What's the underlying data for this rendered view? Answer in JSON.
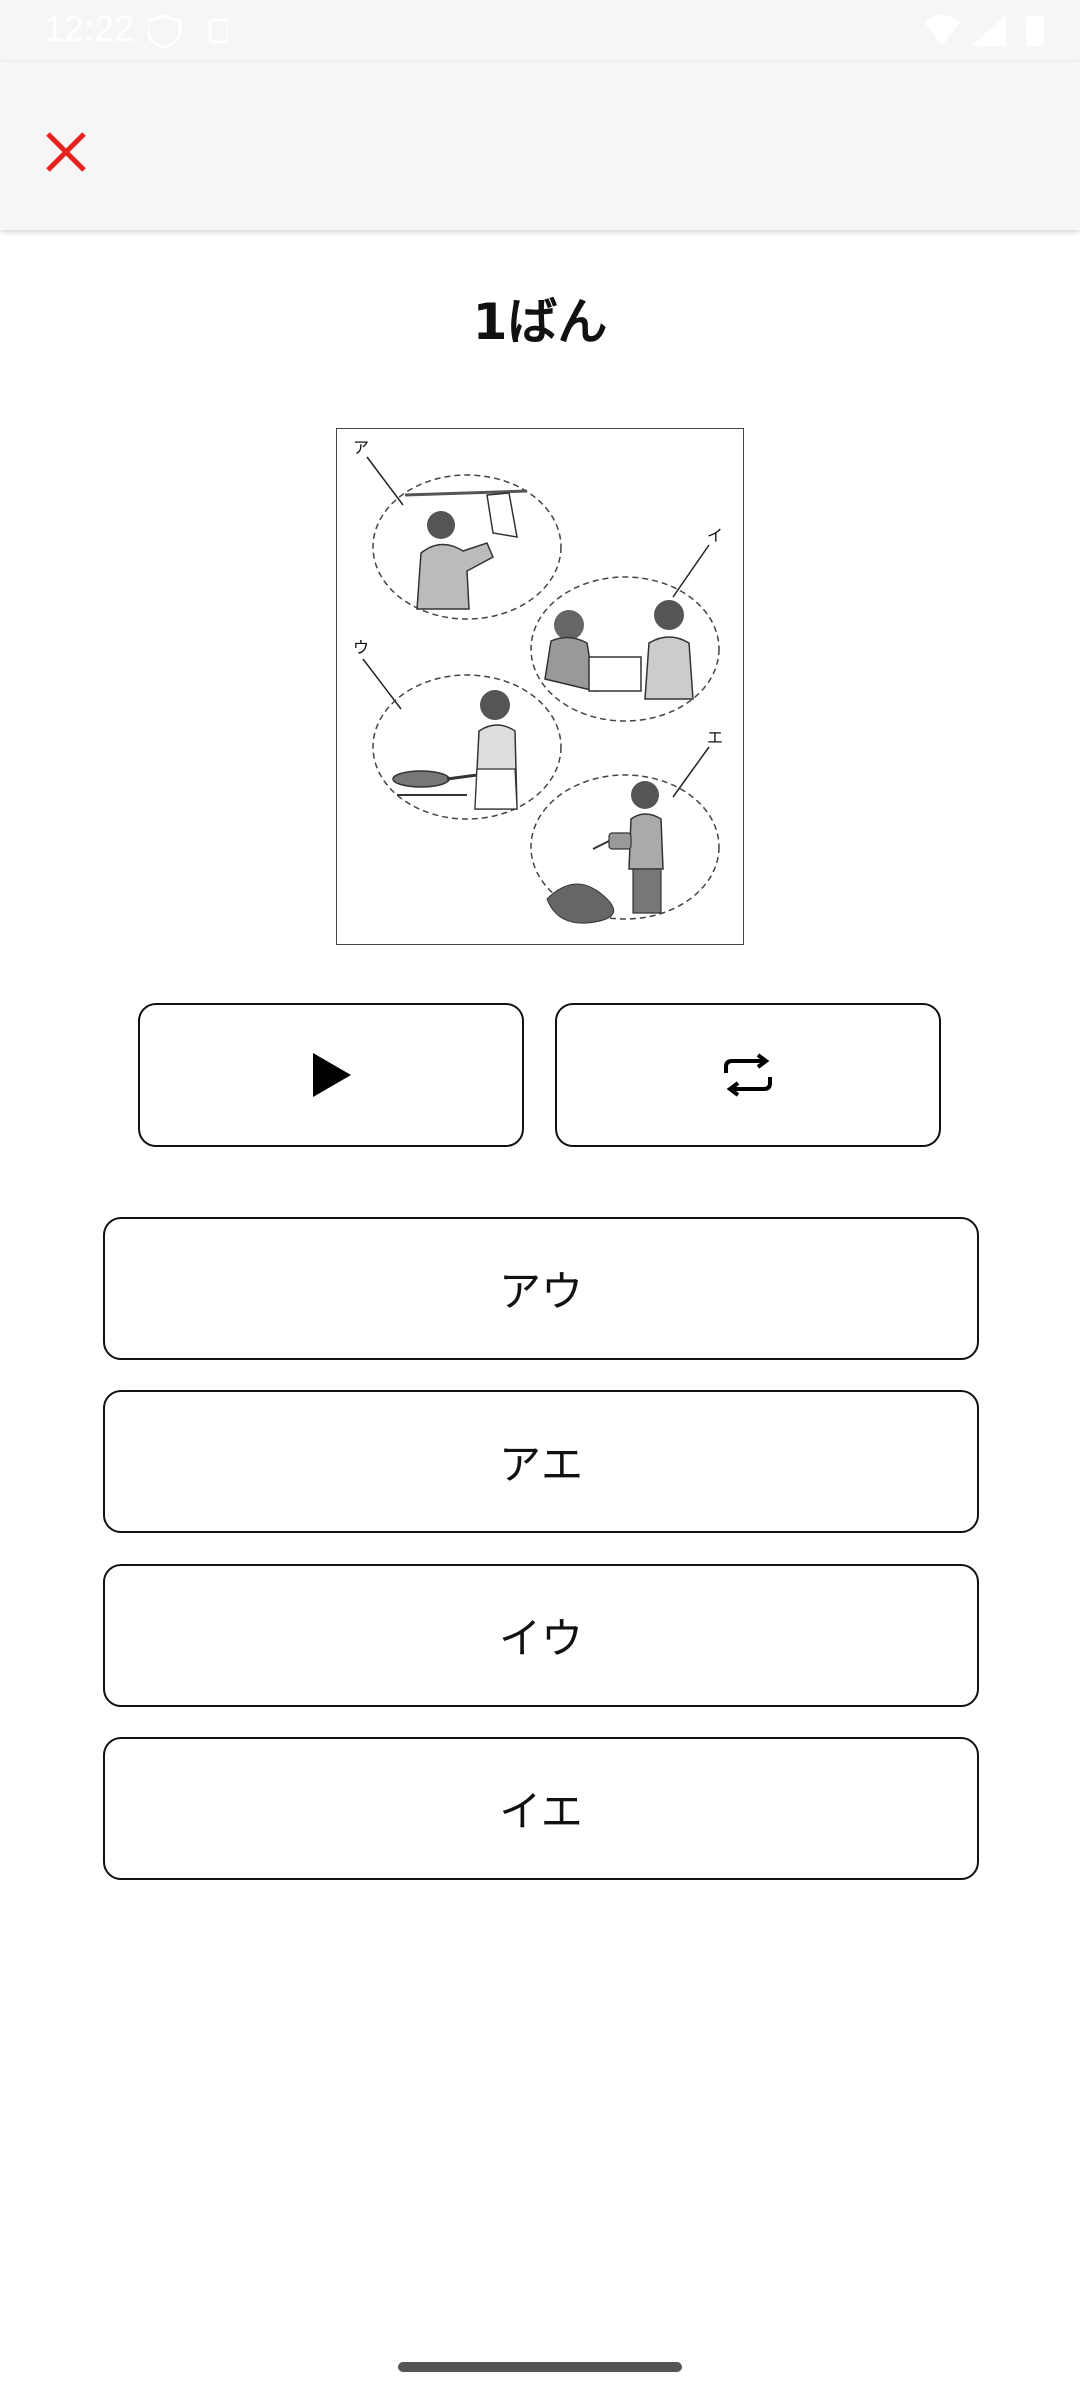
{
  "status_bar": {
    "time": "12:22"
  },
  "header": {
    "close_icon": "close-icon",
    "close_color": "#e8231e"
  },
  "question": {
    "title": "1ばん"
  },
  "illustration": {
    "labels": {
      "a": "ア",
      "i": "イ",
      "u": "ウ",
      "e": "エ"
    }
  },
  "controls": {
    "play_icon": "play-icon",
    "repeat_icon": "repeat-icon"
  },
  "options": [
    {
      "label": "アウ"
    },
    {
      "label": "アエ"
    },
    {
      "label": "イウ"
    },
    {
      "label": "イエ"
    }
  ]
}
